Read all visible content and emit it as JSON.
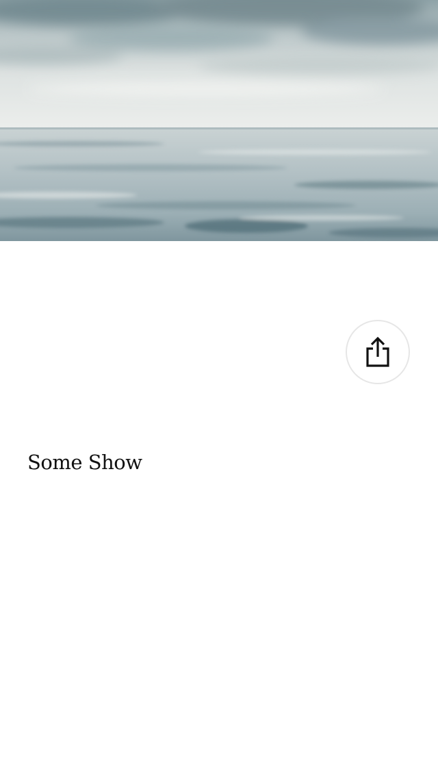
{
  "hero": {
    "image": "seascape-painting",
    "sky_color": "#dfe3e3",
    "water_color": "#a9b8bd"
  },
  "share": {
    "icon": "share-icon"
  },
  "show": {
    "title": "Some Show"
  }
}
